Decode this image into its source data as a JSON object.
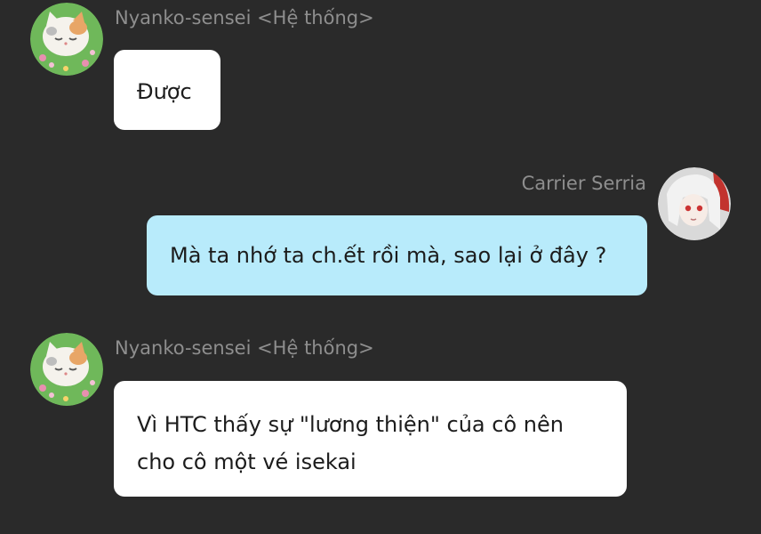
{
  "messages": [
    {
      "sender": "Nyanko-sensei <Hệ thống>",
      "avatar_icon": "nyanko-cat-avatar",
      "text": "Được",
      "bubble_color": "#ffffff"
    },
    {
      "sender": "Carrier Serria",
      "avatar_icon": "serria-girl-avatar",
      "text": "Mà ta nhớ ta ch.ết rồi mà, sao lại ở đây ?",
      "bubble_color": "#b8ebfb"
    },
    {
      "sender": "Nyanko-sensei <Hệ thống>",
      "avatar_icon": "nyanko-cat-avatar",
      "text_lines": [
        "Vì HTC thấy sự \"lương thiện\" của cô nên",
        "cho cô một vé isekai"
      ],
      "bubble_color": "#ffffff"
    }
  ],
  "colors": {
    "background": "#2a2a2a",
    "sender_name": "#8e8e8e",
    "text": "#1c1c1c"
  }
}
